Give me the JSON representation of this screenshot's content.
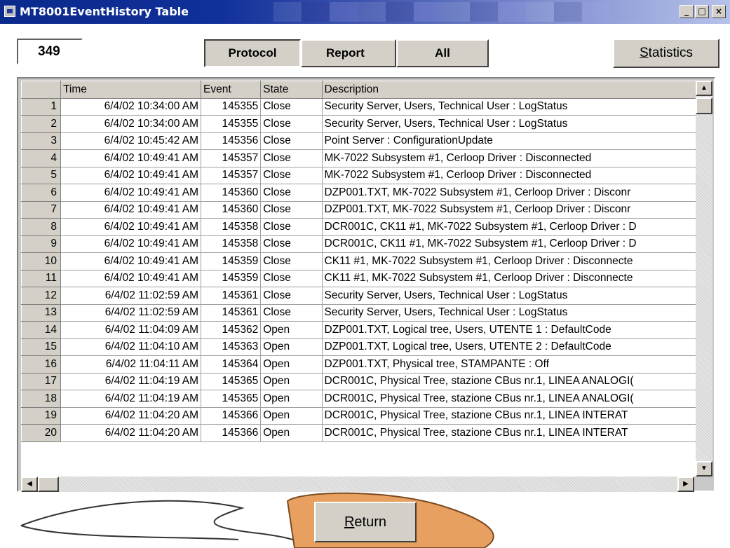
{
  "window": {
    "title": "MT8001EventHistory Table",
    "controls": [
      "_",
      "□",
      "×"
    ]
  },
  "count": "349",
  "tabs": [
    {
      "label": "Protocol",
      "active": true
    },
    {
      "label": "Report",
      "active": false
    },
    {
      "label": "All",
      "active": false
    }
  ],
  "statistics_button": {
    "prefix": "S",
    "rest": "tatistics"
  },
  "return_button": {
    "prefix": "R",
    "rest": "eturn"
  },
  "table": {
    "columns": [
      "",
      "Time",
      "Event",
      "State",
      "Description"
    ],
    "rows": [
      [
        "1",
        "6/4/02 10:34:00 AM",
        "145355",
        "Close",
        "Security Server, Users, Technical User : LogStatus"
      ],
      [
        "2",
        "6/4/02 10:34:00 AM",
        "145355",
        "Close",
        "Security Server, Users, Technical User : LogStatus"
      ],
      [
        "3",
        "6/4/02 10:45:42 AM",
        "145356",
        "Close",
        "Point Server : ConfigurationUpdate"
      ],
      [
        "4",
        "6/4/02 10:49:41 AM",
        "145357",
        "Close",
        "MK-7022 Subsystem #1, Cerloop Driver : Disconnected"
      ],
      [
        "5",
        "6/4/02 10:49:41 AM",
        "145357",
        "Close",
        "MK-7022 Subsystem #1, Cerloop Driver : Disconnected"
      ],
      [
        "6",
        "6/4/02 10:49:41 AM",
        "145360",
        "Close",
        "DZP001.TXT, MK-7022 Subsystem #1, Cerloop Driver : Disconr"
      ],
      [
        "7",
        "6/4/02 10:49:41 AM",
        "145360",
        "Close",
        "DZP001.TXT, MK-7022 Subsystem #1, Cerloop Driver : Disconr"
      ],
      [
        "8",
        "6/4/02 10:49:41 AM",
        "145358",
        "Close",
        "DCR001C, CK11 #1, MK-7022 Subsystem #1, Cerloop Driver : D"
      ],
      [
        "9",
        "6/4/02 10:49:41 AM",
        "145358",
        "Close",
        "DCR001C, CK11 #1, MK-7022 Subsystem #1, Cerloop Driver : D"
      ],
      [
        "10",
        "6/4/02 10:49:41 AM",
        "145359",
        "Close",
        "CK11 #1, MK-7022 Subsystem #1, Cerloop Driver : Disconnecte"
      ],
      [
        "11",
        "6/4/02 10:49:41 AM",
        "145359",
        "Close",
        "CK11 #1, MK-7022 Subsystem #1, Cerloop Driver : Disconnecte"
      ],
      [
        "12",
        "6/4/02 11:02:59 AM",
        "145361",
        "Close",
        "Security Server, Users, Technical User : LogStatus"
      ],
      [
        "13",
        "6/4/02 11:02:59 AM",
        "145361",
        "Close",
        "Security Server, Users, Technical User : LogStatus"
      ],
      [
        "14",
        "6/4/02 11:04:09 AM",
        "145362",
        "Open",
        "DZP001.TXT, Logical tree, Users, UTENTE 1 : DefaultCode"
      ],
      [
        "15",
        "6/4/02 11:04:10 AM",
        "145363",
        "Open",
        "DZP001.TXT, Logical tree, Users, UTENTE 2 : DefaultCode"
      ],
      [
        "16",
        "6/4/02 11:04:11 AM",
        "145364",
        "Open",
        "DZP001.TXT, Physical tree, STAMPANTE : Off"
      ],
      [
        "17",
        "6/4/02 11:04:19 AM",
        "145365",
        "Open",
        "DCR001C, Physical Tree, stazione CBus nr.1, LINEA ANALOGI("
      ],
      [
        "18",
        "6/4/02 11:04:19 AM",
        "145365",
        "Open",
        "DCR001C, Physical Tree, stazione CBus nr.1, LINEA ANALOGI("
      ],
      [
        "19",
        "6/4/02 11:04:20 AM",
        "145366",
        "Open",
        "DCR001C, Physical Tree, stazione CBus nr.1, LINEA INTERAT"
      ],
      [
        "20",
        "6/4/02 11:04:20 AM",
        "145366",
        "Open",
        "DCR001C, Physical Tree, stazione CBus nr.1, LINEA INTERAT"
      ]
    ]
  }
}
